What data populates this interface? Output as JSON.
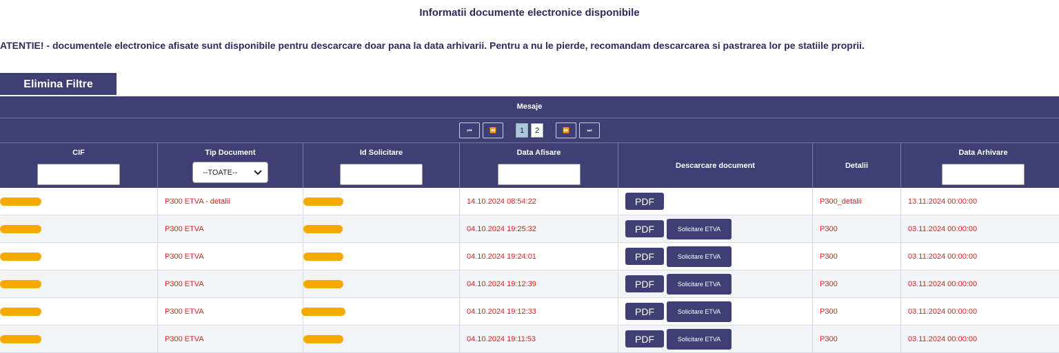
{
  "title": "Informatii documente electronice disponibile",
  "warning": "ATENTIE! - documentele electronice afisate sunt disponibile pentru descarcare doar pana la data arhivarii. Pentru a nu le pierde, recomandam descarcarea si pastrarea lor pe statiile proprii.",
  "clear_filters_label": "Elimina Filtre",
  "grid": {
    "caption": "Mesaje",
    "pager": {
      "first_glyph": "⏮",
      "prev_glyph": "⏪",
      "next_glyph": "⏩",
      "last_glyph": "⏭",
      "pages": [
        "1",
        "2"
      ],
      "current_page": "1"
    },
    "headers": {
      "cif": "CIF",
      "tip_document": "Tip Document",
      "id_solicitare": "Id Solicitare",
      "data_afisare": "Data Afisare",
      "descarcare": "Descarcare document",
      "detalii": "Detalii",
      "data_arhivare": "Data Arhivare"
    },
    "tip_document_filter": "--TOATE--",
    "pdf_label": "PDF",
    "solicitare_label": "Solicitare ETVA",
    "rows": [
      {
        "tip": "P300 ETVA - detalii",
        "data_afisare": "14.10.2024 08:54:22",
        "detalii": "P300_detalii",
        "data_arhivare": "13.11.2024 00:00:00"
      },
      {
        "tip": "P300 ETVA",
        "data_afisare": "04.10.2024 19:25:32",
        "detalii": "P300",
        "data_arhivare": "03.11.2024 00:00:00"
      },
      {
        "tip": "P300 ETVA",
        "data_afisare": "04.10.2024 19:24:01",
        "detalii": "P300",
        "data_arhivare": "03.11.2024 00:00:00"
      },
      {
        "tip": "P300 ETVA",
        "data_afisare": "04.10.2024 19:12:39",
        "detalii": "P300",
        "data_arhivare": "03.11.2024 00:00:00"
      },
      {
        "tip": "P300 ETVA",
        "data_afisare": "04.10.2024 19:12:33",
        "detalii": "P300",
        "data_arhivare": "03.11.2024 00:00:00"
      },
      {
        "tip": "P300 ETVA",
        "data_afisare": "04.10.2024 19:11:53",
        "detalii": "P300",
        "data_arhivare": "03.11.2024 00:00:00"
      }
    ]
  },
  "colors": {
    "header_bg": "#3f3f76",
    "cell_text": "#e0201c",
    "redaction": "#f5a800"
  }
}
